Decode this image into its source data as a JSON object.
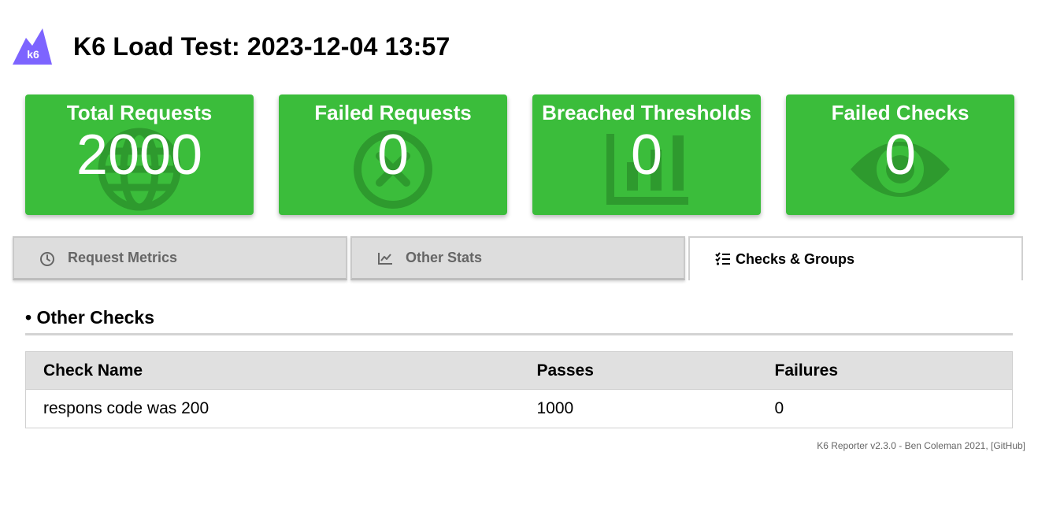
{
  "header": {
    "logo_text": "k6",
    "title": "K6 Load Test: 2023-12-04 13:57"
  },
  "colors": {
    "card_green": "#3bbd3b",
    "logo_purple": "#7d64ff"
  },
  "cards": [
    {
      "title": "Total Requests",
      "value": "2000",
      "icon": "globe-icon"
    },
    {
      "title": "Failed Requests",
      "value": "0",
      "icon": "times-circle-icon"
    },
    {
      "title": "Breached Thresholds",
      "value": "0",
      "icon": "chart-bar-icon"
    },
    {
      "title": "Failed Checks",
      "value": "0",
      "icon": "eye-icon"
    }
  ],
  "tabs": [
    {
      "label": "Request Metrics",
      "icon": "clock-icon",
      "active": false
    },
    {
      "label": "Other Stats",
      "icon": "chart-line-icon",
      "active": false
    },
    {
      "label": "Checks & Groups",
      "icon": "tasks-icon",
      "active": true
    }
  ],
  "section": {
    "title": "• Other Checks"
  },
  "table": {
    "headers": [
      "Check Name",
      "Passes",
      "Failures"
    ],
    "rows": [
      [
        "respons code was 200",
        "1000",
        "0"
      ]
    ]
  },
  "footer": {
    "text": "K6 Reporter v2.3.0 - Ben Coleman 2021, [GitHub]"
  }
}
